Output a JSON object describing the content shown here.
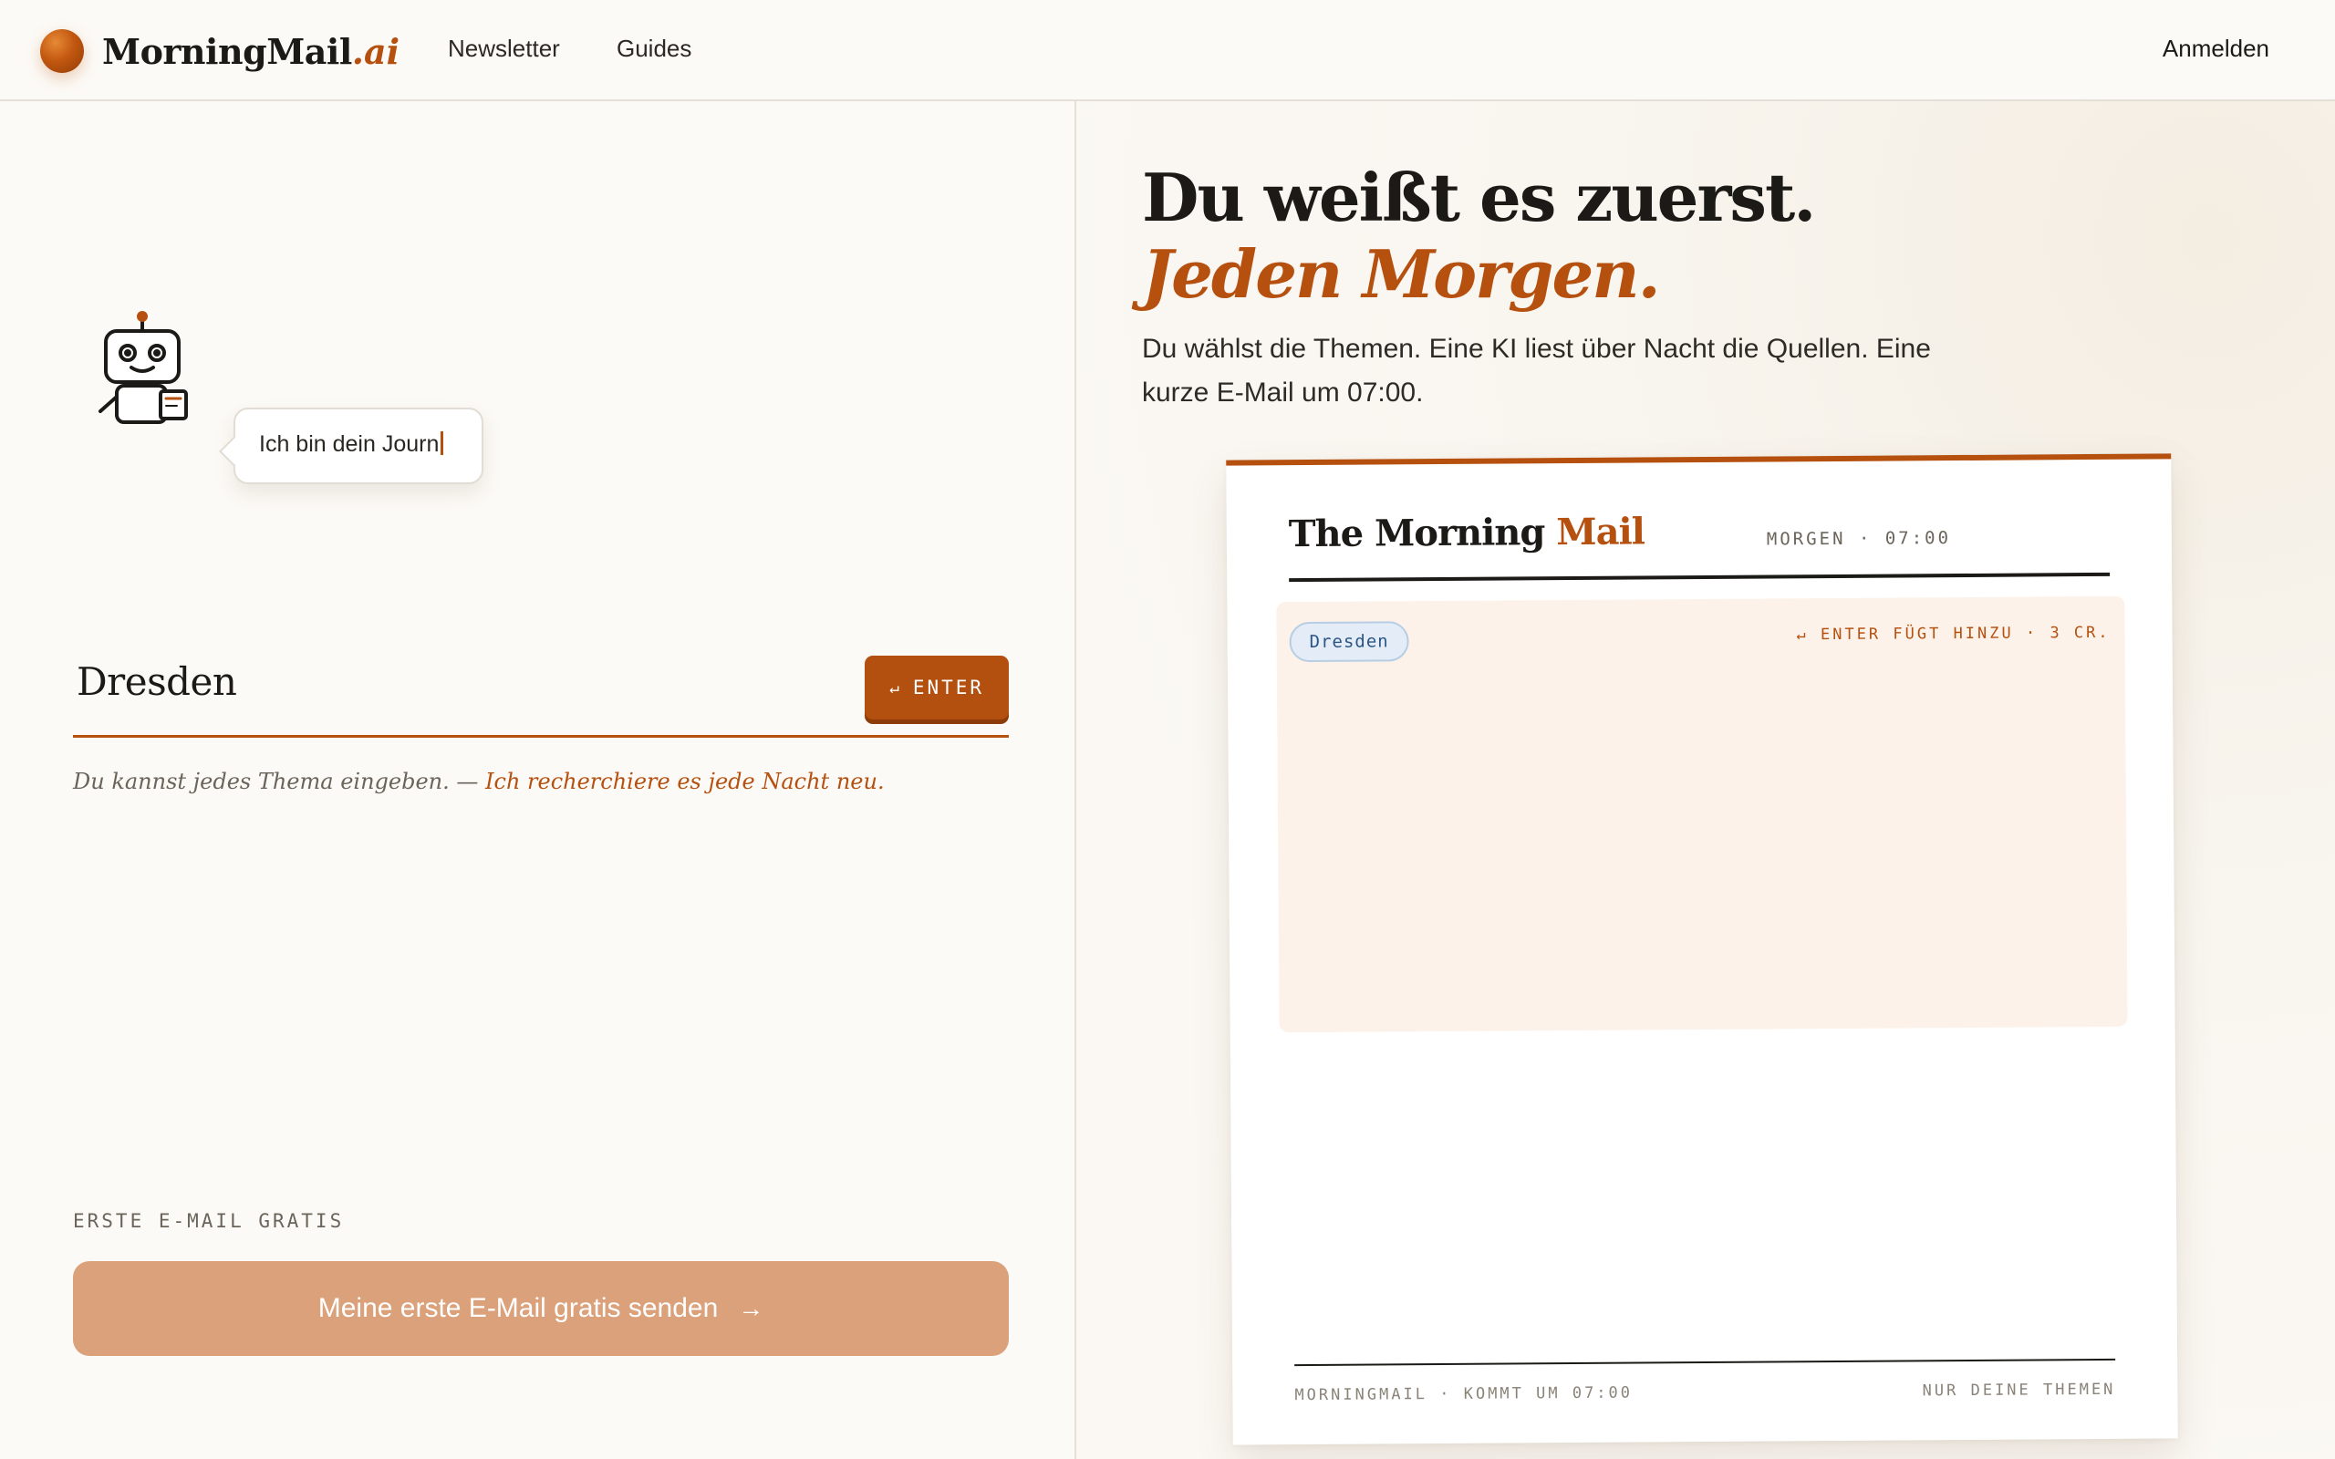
{
  "brand": {
    "name": "MorningMail",
    "suffix": ".ai",
    "accent_color": "#b5500f"
  },
  "nav": {
    "items": [
      {
        "label": "Newsletter"
      },
      {
        "label": "Guides"
      }
    ],
    "login_label": "Anmelden"
  },
  "onboarding": {
    "robot_icon": "robot-mascot-icon",
    "speech_text": "Ich bin dein Journ",
    "topic_input_value": "Dresden",
    "enter_button_label": "ENTER",
    "enter_icon": "↵",
    "hint_text": "Du kannst jedes Thema eingeben. — ",
    "hint_accent": "Ich recherchiere es jede Nacht neu.",
    "free_label": "ERSTE E-MAIL GRATIS",
    "cta_label": "Meine erste E-Mail gratis senden",
    "cta_arrow": "→",
    "cta_color": "#dba17a"
  },
  "hero": {
    "headline": "Du weißt es zuerst.",
    "headline_accent": "Jeden Morgen.",
    "lede": "Du wählst die Themen. Eine KI liest über Nacht die Quellen. Eine kurze E-Mail um 07:00."
  },
  "preview": {
    "title_prefix": "The Morning ",
    "title_accent": "Mail",
    "time_label": "MORGEN · 07:00",
    "topic_chip": "Dresden",
    "inbox_hint": "↵ ENTER FÜGT HINZU · 3 CR.",
    "footer_left": "MORNINGMAIL · KOMMT UM 07:00",
    "footer_right": "NUR DEINE THEMEN"
  }
}
